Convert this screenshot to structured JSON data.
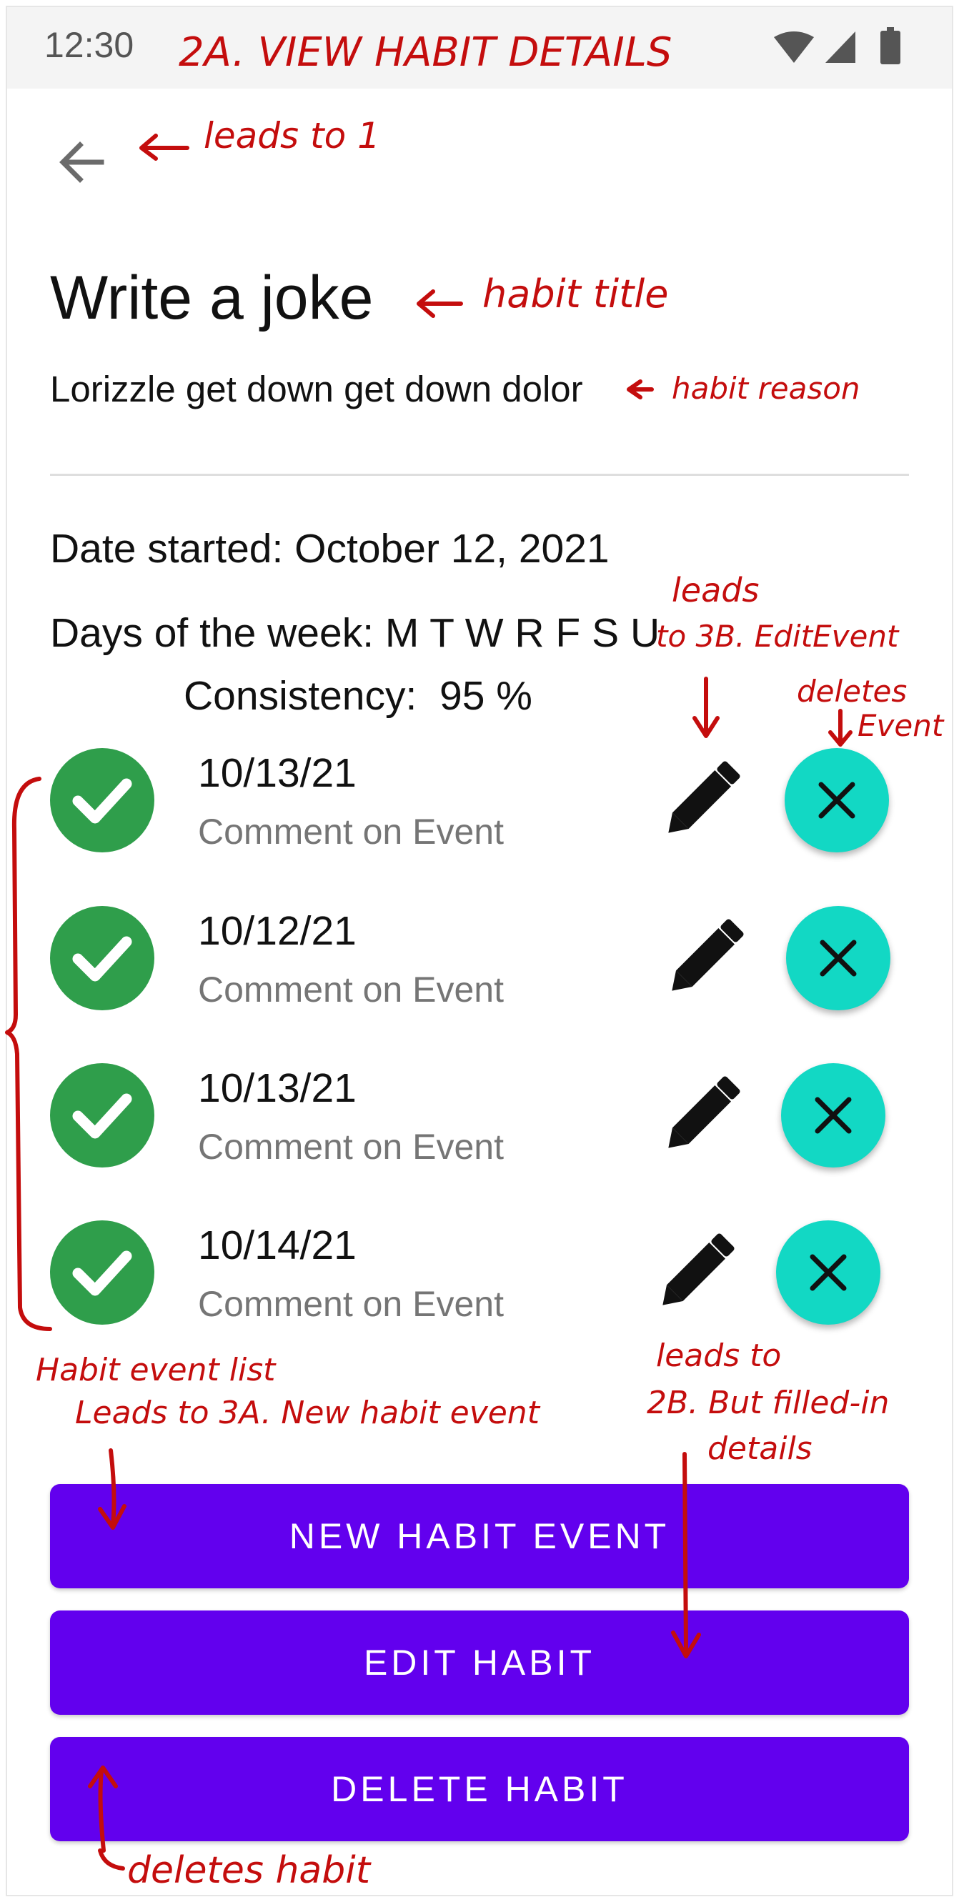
{
  "status_bar": {
    "time": "12:30"
  },
  "header": {
    "back_label": "leads to 1"
  },
  "habit": {
    "title": "Write a joke",
    "reason": "Lorizzle get down get down dolor",
    "date_started": "Date started: October 12, 2021",
    "days_of_week": "Days of the week: M T W R F S U",
    "consistency_label": "Consistency:",
    "consistency_value": "95 %"
  },
  "events": [
    {
      "date": "10/13/21",
      "comment": "Comment on Event"
    },
    {
      "date": "10/12/21",
      "comment": "Comment on Event"
    },
    {
      "date": "10/13/21",
      "comment": "Comment on Event"
    },
    {
      "date": "10/14/21",
      "comment": "Comment on Event"
    }
  ],
  "buttons": {
    "new_event": "NEW HABIT EVENT",
    "edit": "EDIT HABIT",
    "delete": "DELETE HABIT"
  },
  "annotations": {
    "screen_title": "2A. VIEW HABIT DETAILS",
    "back": "leads to 1",
    "title": "habit title",
    "reason": "habit reason",
    "edit_event_1": "leads",
    "edit_event_2": "to 3B. EditEvent",
    "delete_event_1": "deletes",
    "delete_event_2": "Event",
    "list": "Habit event list",
    "new_event": "Leads to 3A. New habit event",
    "edit_habit_1": "leads to",
    "edit_habit_2": "2B. But filled-in",
    "edit_habit_3": "details",
    "delete_habit": "deletes habit"
  },
  "colors": {
    "primary_button": "#6200ee",
    "check_green": "#2f9e4b",
    "delete_fab": "#12d8c4",
    "annotation_red": "#c40d0d",
    "status_bar_bg": "#f4f4f4"
  },
  "icons": [
    "back-arrow-icon",
    "wifi-icon",
    "signal-icon",
    "battery-icon",
    "check-icon",
    "pencil-icon",
    "close-icon"
  ]
}
